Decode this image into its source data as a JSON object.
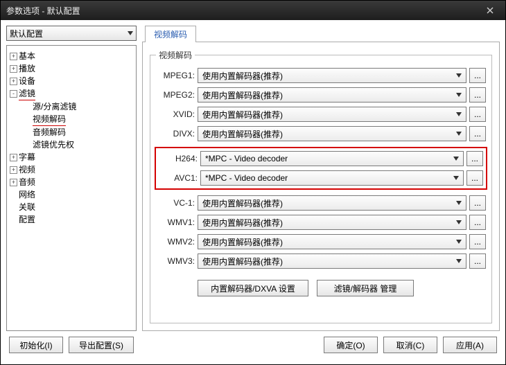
{
  "window": {
    "title": "参数选项 - 默认配置"
  },
  "profile": {
    "selected": "默认配置"
  },
  "tree": {
    "basic": "基本",
    "playback": "播放",
    "device": "设备",
    "filters": "滤镜",
    "filters_children": {
      "source_splitter": "源/分离滤镜",
      "video_decode": "视频解码",
      "audio_decode": "音频解码",
      "filter_priority": "滤镜优先权"
    },
    "subtitle": "字幕",
    "video": "视频",
    "audio": "音频",
    "network": "网络",
    "assoc": "关联",
    "config": "配置"
  },
  "tab": {
    "label": "视频解码"
  },
  "group": {
    "legend": "视频解码"
  },
  "decoders": {
    "mpeg1": {
      "label": "MPEG1:",
      "value": "使用内置解码器(推荐)"
    },
    "mpeg2": {
      "label": "MPEG2:",
      "value": "使用内置解码器(推荐)"
    },
    "xvid": {
      "label": "XVID:",
      "value": "使用内置解码器(推荐)"
    },
    "divx": {
      "label": "DIVX:",
      "value": "使用内置解码器(推荐)"
    },
    "h264": {
      "label": "H264:",
      "value": "*MPC - Video decoder"
    },
    "avc1": {
      "label": "AVC1:",
      "value": "*MPC - Video decoder"
    },
    "vc1": {
      "label": "VC-1:",
      "value": "使用内置解码器(推荐)"
    },
    "wmv1": {
      "label": "WMV1:",
      "value": "使用内置解码器(推荐)"
    },
    "wmv2": {
      "label": "WMV2:",
      "value": "使用内置解码器(推荐)"
    },
    "wmv3": {
      "label": "WMV3:",
      "value": "使用内置解码器(推荐)"
    }
  },
  "dots": "...",
  "actions": {
    "dxva": "内置解码器/DXVA 设置",
    "manage": "滤镜/解码器 管理"
  },
  "footer": {
    "init": "初始化(I)",
    "export": "导出配置(S)",
    "ok": "确定(O)",
    "cancel": "取消(C)",
    "apply": "应用(A)"
  }
}
